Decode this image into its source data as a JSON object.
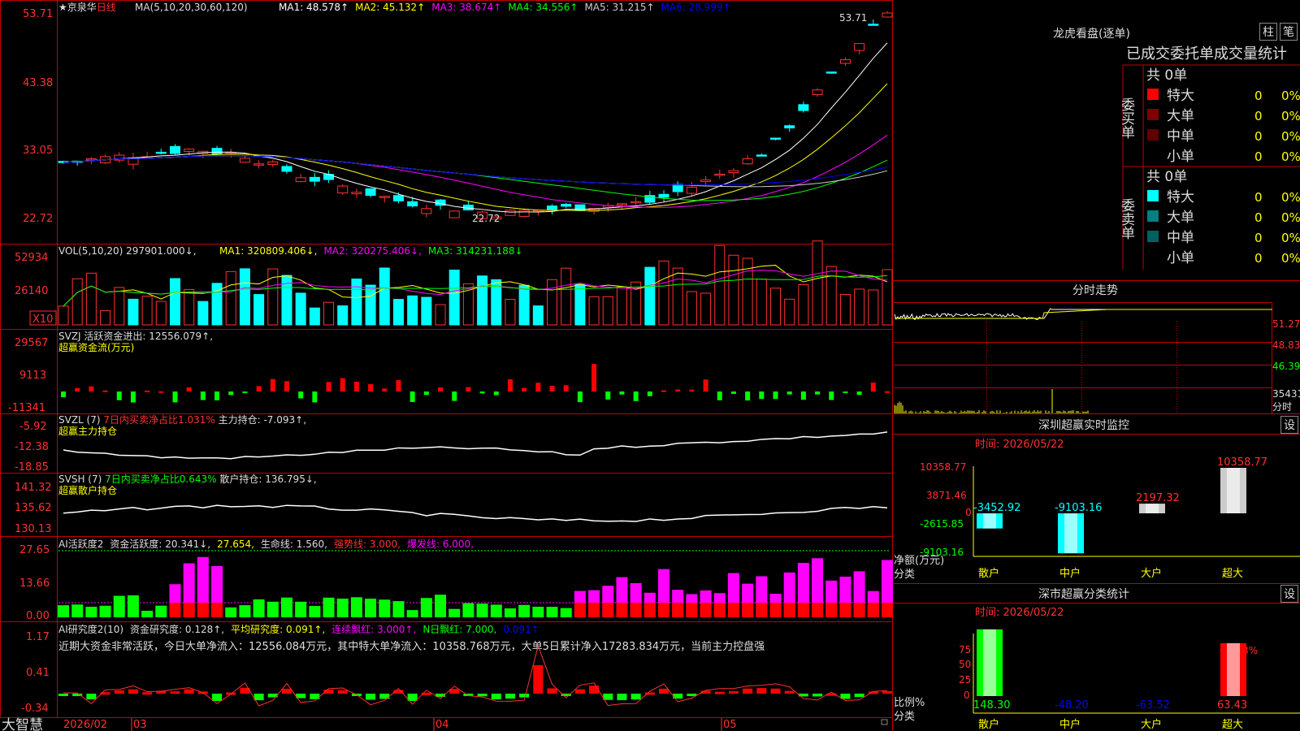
{
  "stock": {
    "name": "京泉华",
    "period": "日线",
    "star": "★"
  },
  "main_panel": {
    "ma_header": "MA(5,10,20,30,60,120)",
    "ma_items": [
      {
        "label": "MA1: 48.578↑",
        "color": "#ffffff"
      },
      {
        "label": "MA2: 45.132↑",
        "color": "#ffff00"
      },
      {
        "label": "MA3: 38.674↑",
        "color": "#ff00ff"
      },
      {
        "label": "MA4: 34.556↑",
        "color": "#00ff00"
      },
      {
        "label": "MA5: 31.215↑",
        "color": "#cccccc"
      },
      {
        "label": "MA6: 28.999↑",
        "color": "#0000ff"
      }
    ],
    "y_ticks": [
      "53.71",
      "43.38",
      "33.05",
      "22.72"
    ],
    "high_label": "53.71",
    "low_label": "22.72"
  },
  "vol_panel": {
    "header": "VOL(5,10,20)",
    "value": "297901.000↓,",
    "items": [
      {
        "label": "MA1: 320809.406↓,",
        "color": "#ffff00"
      },
      {
        "label": "MA2: 320275.406↓,",
        "color": "#ff00ff"
      },
      {
        "label": "MA3: 314231.188↓",
        "color": "#00ff00"
      }
    ],
    "y_ticks": [
      "52934",
      "26140"
    ],
    "unit": "X10"
  },
  "svzj_panel": {
    "line1": "SVZJ  活跃资金进出: 12556.079↑,",
    "line2": "超赢资金流(万元)",
    "y_ticks": [
      "29567",
      "9113",
      "-11341"
    ]
  },
  "svzl_panel": {
    "head": "SVZL (7)",
    "mid": "7日内买卖净占比1.031%",
    "tail": "主力持仓: -7.093↑,",
    "line2": "超赢主力持仓",
    "y_ticks": [
      "-5.92",
      "-12.38",
      "-18.85"
    ]
  },
  "svsh_panel": {
    "head": "SVSH (7)",
    "mid": "7日内买卖净占比0.643%",
    "tail": "散户持仓: 136.795↓,",
    "line2": "超赢散户持仓",
    "y_ticks": [
      "141.32",
      "135.62",
      "130.13"
    ]
  },
  "ai_active_panel": {
    "items": [
      {
        "label": "AI活跃度2",
        "color": "#dddddd"
      },
      {
        "label": "资金活跃度: 20.341↓,",
        "color": "#dddddd"
      },
      {
        "label": "27.654,",
        "color": "#ffff00"
      },
      {
        "label": "生命线: 1.560,",
        "color": "#dddddd"
      },
      {
        "label": "强势线: 3.000,",
        "color": "#ff3030"
      },
      {
        "label": "爆发线: 6.000,",
        "color": "#ff00ff"
      }
    ],
    "y_ticks": [
      "27.65",
      "13.66",
      "0.00"
    ]
  },
  "ai_research_panel": {
    "items": [
      {
        "label": "AI研究度2(10)",
        "color": "#dddddd"
      },
      {
        "label": "资金研究度: 0.128↑,",
        "color": "#dddddd"
      },
      {
        "label": "平均研究度: 0.091↑,",
        "color": "#ffff00"
      },
      {
        "label": "连续飘红: 3.000↑,",
        "color": "#ff00ff"
      },
      {
        "label": "N日飘红: 7.000,",
        "color": "#00ff00"
      },
      {
        "label": "0.091↑",
        "color": "#0000ff"
      }
    ],
    "summary": "近期大资金非常活跃，今日大单净流入：12556.084万元，其中特大单净流入：10358.768万元，大单5日累计净入17283.834万元，当前主力控盘强",
    "y_ticks": [
      "1.17",
      "0.41",
      "-0.34"
    ]
  },
  "bottom_bar": {
    "app": "大智慧",
    "dates": [
      "2026/02",
      "03",
      "04",
      "05"
    ]
  },
  "dragon_tiger": {
    "title": "龙虎看盘(逐单)",
    "btn_bar": "柱",
    "btn_pen": "笔",
    "header": "已成交委托单成交量统计",
    "buy": {
      "label": "委买单",
      "total": "共 0单",
      "rows": [
        {
          "name": "特大",
          "count": "0",
          "pct": "0%",
          "color": "#ff0000"
        },
        {
          "name": "大单",
          "count": "0",
          "pct": "0%",
          "color": "#800000"
        },
        {
          "name": "中单",
          "count": "0",
          "pct": "0%",
          "color": "#600000"
        },
        {
          "name": "小单",
          "count": "0",
          "pct": "0%",
          "color": ""
        }
      ]
    },
    "sell": {
      "label": "委卖单",
      "total": "共 0单",
      "rows": [
        {
          "name": "特大",
          "count": "0",
          "pct": "0%",
          "color": "#00ffff"
        },
        {
          "name": "大单",
          "count": "0",
          "pct": "0%",
          "color": "#008080"
        },
        {
          "name": "中单",
          "count": "0",
          "pct": "0%",
          "color": "#006060"
        },
        {
          "name": "小单",
          "count": "0",
          "pct": "0%",
          "color": ""
        }
      ]
    }
  },
  "intraday": {
    "title": "分时走势",
    "y_ticks": [
      "51.27",
      "48.83",
      "46.39"
    ],
    "vol_label": "35431",
    "fen": "分时"
  },
  "sz_monitor": {
    "title": "深圳超赢实时监控",
    "settings": "设",
    "date": "时间: 2026/05/22",
    "y_ticks": [
      "10358.77",
      "3871.46",
      "0",
      "-2615.85",
      "-9103.16"
    ],
    "axis_label": "净额(万元)",
    "axis_label2": "分类",
    "chart_data": {
      "type": "bar",
      "categories": [
        "散户",
        "中户",
        "大户",
        "超大"
      ],
      "values": [
        -3452.92,
        -9103.16,
        2197.32,
        10358.77
      ],
      "value_labels": [
        "-3452.92",
        "-9103.16",
        "2197.32",
        "10358.77"
      ],
      "ylabel": "净额(万元)",
      "xlabel": "分类",
      "ylim": [
        -9103.16,
        10358.77
      ]
    }
  },
  "sz_class": {
    "title": "深市超赢分类统计",
    "settings": "设",
    "date": "时间: 2026/05/22",
    "y_ticks": [
      "75",
      "50",
      "25",
      "0"
    ],
    "axis_label": "比例%",
    "axis_label2": "分类",
    "pct_label": "+0.83%",
    "chart_data": {
      "type": "bar",
      "categories": [
        "散户",
        "中户",
        "大户",
        "超大"
      ],
      "values": [
        148.3,
        -48.2,
        -63.52,
        63.43
      ],
      "value_labels": [
        "148.30",
        "-48.20",
        "-63.52",
        "63.43"
      ],
      "ylabel": "比例%",
      "xlabel": "分类",
      "ylim": [
        0,
        75
      ]
    }
  }
}
